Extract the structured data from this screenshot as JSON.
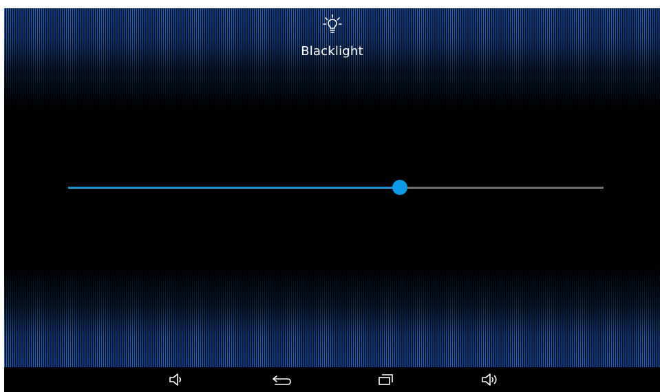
{
  "screen": {
    "title": "Blacklight",
    "title_icon": "lightbulb-icon"
  },
  "slider": {
    "name": "backlight-brightness",
    "value_percent": 62,
    "fill_color": "#1c94d4",
    "track_color": "#6f6f6f",
    "thumb_color": "#0b9ae8"
  },
  "navbar": {
    "buttons": [
      {
        "icon": "volume-down-icon"
      },
      {
        "icon": "back-icon"
      },
      {
        "icon": "recent-apps-icon"
      },
      {
        "icon": "volume-up-icon"
      }
    ]
  },
  "colors": {
    "accent": "#0b9ae8",
    "texture": "#286ec8",
    "background": "#000000"
  }
}
